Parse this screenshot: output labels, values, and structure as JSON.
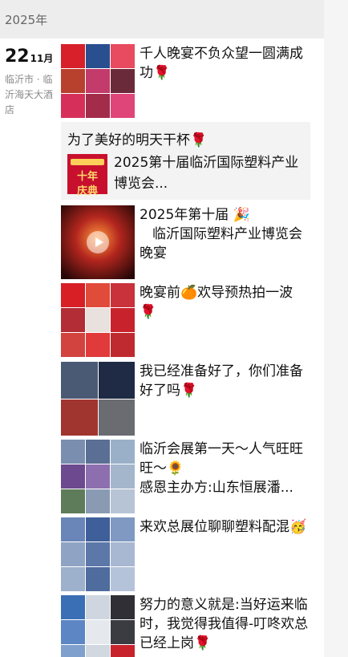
{
  "year": "2025年",
  "date": {
    "day": "22",
    "month": "11月",
    "location": "临沂市 · 临沂海天大酒店"
  },
  "posts": [
    {
      "text": "千人晚宴不负众望一圆满成功🌹"
    },
    {
      "text": "为了美好的明天干杯🌹",
      "share_title": "2025第十届临沂国际塑料产业博览会...",
      "share_thumb_text": "十年庆典"
    },
    {
      "text_line1": "2025年第十届 🎉",
      "text_line2": "临沂国际塑料产业博览会晚宴"
    },
    {
      "text": "晚宴前🍊欢导预热拍一波🌹"
    },
    {
      "text": "我已经准备好了，你们准备好了吗🌹"
    },
    {
      "text_line1": "临沂会展第一天～人气旺旺旺～🌻",
      "text_line2": "感恩主办方:山东恒展潘..."
    },
    {
      "text": "来欢总展位聊聊塑料配混🥳"
    },
    {
      "text": "努力的意义就是:当好运来临时，我觉得我值得-叮咚欢总已经上岗🌹"
    }
  ],
  "colors": {
    "year_bar": "#ededed",
    "accent_red": "#c4161c",
    "share_bg": "#f3f3f3"
  }
}
